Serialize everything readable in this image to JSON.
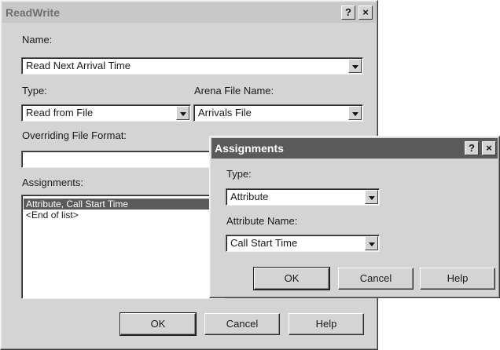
{
  "readwrite": {
    "title": "ReadWrite",
    "help_glyph": "?",
    "close_glyph": "×",
    "name_label": "Name:",
    "name_value": "Read Next Arrival Time",
    "type_label": "Type:",
    "type_value": "Read from File",
    "arena_label": "Arena File Name:",
    "arena_value": "Arrivals File",
    "override_label": "Overriding File Format:",
    "override_value": "",
    "assign_label": "Assignments:",
    "assign_items": [
      "Attribute, Call Start Time",
      "<End of list>"
    ],
    "ok": "OK",
    "cancel": "Cancel",
    "help": "Help"
  },
  "assignments": {
    "title": "Assignments",
    "help_glyph": "?",
    "close_glyph": "×",
    "type_label": "Type:",
    "type_value": "Attribute",
    "attr_label": "Attribute Name:",
    "attr_value": "Call Start Time",
    "ok": "OK",
    "cancel": "Cancel",
    "help": "Help"
  },
  "icons": {
    "dropdown": "triangle-down",
    "help": "question-mark",
    "close": "x"
  },
  "colors": {
    "dialog_face": "#d4d4d4",
    "active_title": "#5a5a5a",
    "inactive_title": "#c8c8c8",
    "selection": "#5a5a5a"
  }
}
